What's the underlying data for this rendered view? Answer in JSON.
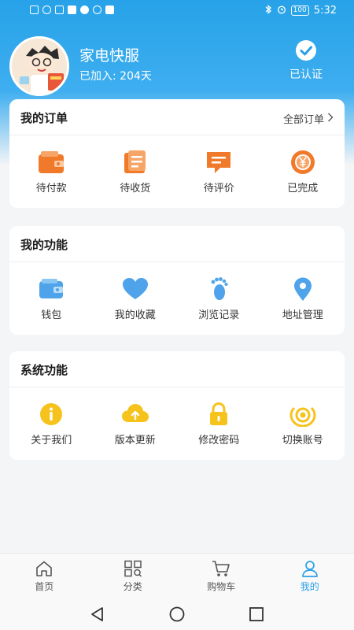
{
  "colors": {
    "accent": "#2aa0e6",
    "orange": "#f07a2a",
    "blue": "#4ea3ea",
    "yellow": "#f6c21c"
  },
  "status_bar": {
    "battery": "100",
    "time": "5:32"
  },
  "profile": {
    "name": "家电快服",
    "joined": "已加入: 204天",
    "certified_label": "已认证"
  },
  "orders": {
    "title": "我的订单",
    "all_label": "全部订单",
    "items": [
      {
        "label": "待付款",
        "icon": "wallet-icon"
      },
      {
        "label": "待收货",
        "icon": "package-icon"
      },
      {
        "label": "待评价",
        "icon": "comment-icon"
      },
      {
        "label": "已完成",
        "icon": "yen-coin-icon"
      }
    ]
  },
  "features": {
    "title": "我的功能",
    "items": [
      {
        "label": "钱包",
        "icon": "wallet-icon"
      },
      {
        "label": "我的收藏",
        "icon": "heart-icon"
      },
      {
        "label": "浏览记录",
        "icon": "footprint-icon"
      },
      {
        "label": "地址管理",
        "icon": "location-pin-icon"
      }
    ]
  },
  "system": {
    "title": "系统功能",
    "items": [
      {
        "label": "关于我们",
        "icon": "info-icon"
      },
      {
        "label": "版本更新",
        "icon": "cloud-upload-icon"
      },
      {
        "label": "修改密码",
        "icon": "lock-icon"
      },
      {
        "label": "切换账号",
        "icon": "switch-account-icon"
      }
    ]
  },
  "tabbar": {
    "items": [
      {
        "label": "首页",
        "icon": "home-icon"
      },
      {
        "label": "分类",
        "icon": "category-icon"
      },
      {
        "label": "购物车",
        "icon": "cart-icon"
      },
      {
        "label": "我的",
        "icon": "user-icon",
        "active": true
      }
    ]
  }
}
